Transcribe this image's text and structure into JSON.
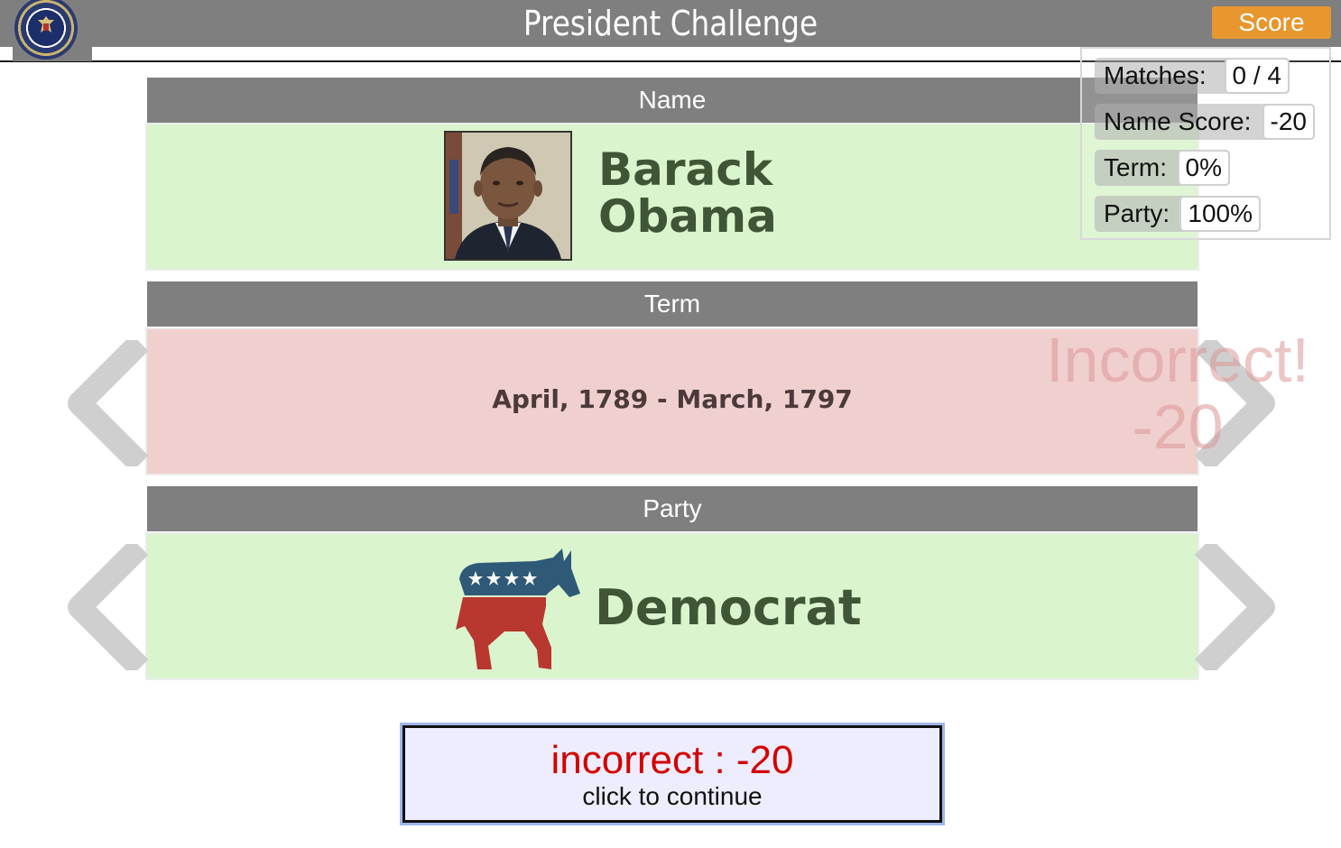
{
  "header": {
    "title": "President Challenge",
    "score_button": "Score"
  },
  "name_section": {
    "heading": "Name",
    "president_name": "Barack Obama",
    "status": "correct"
  },
  "term_section": {
    "heading": "Term",
    "term": "April, 1789 - March, 1797",
    "status": "incorrect"
  },
  "party_section": {
    "heading": "Party",
    "party": "Democrat",
    "status": "correct"
  },
  "feedback_overlay": {
    "result": "Incorrect!",
    "points": "-20"
  },
  "score_panel": {
    "matches_label": "Matches:",
    "matches_value": "0 / 4",
    "name_score_label": "Name Score:",
    "name_score_value": "-20",
    "term_label": "Term:",
    "term_value": "0%",
    "party_label": "Party:",
    "party_value": "100%"
  },
  "continue_box": {
    "result": "incorrect : -20",
    "hint": "click to continue"
  },
  "icons": {
    "seal": "presidential-seal-icon",
    "portrait": "president-portrait-image",
    "party_logo": "democratic-donkey-icon",
    "prev": "chevron-left-icon",
    "next": "chevron-right-icon"
  },
  "colors": {
    "header_gray": "#7f7f7f",
    "score_orange": "#e8972e",
    "correct_green": "#daf4cd",
    "incorrect_red": "#efd0ce",
    "result_red": "#d40000"
  }
}
